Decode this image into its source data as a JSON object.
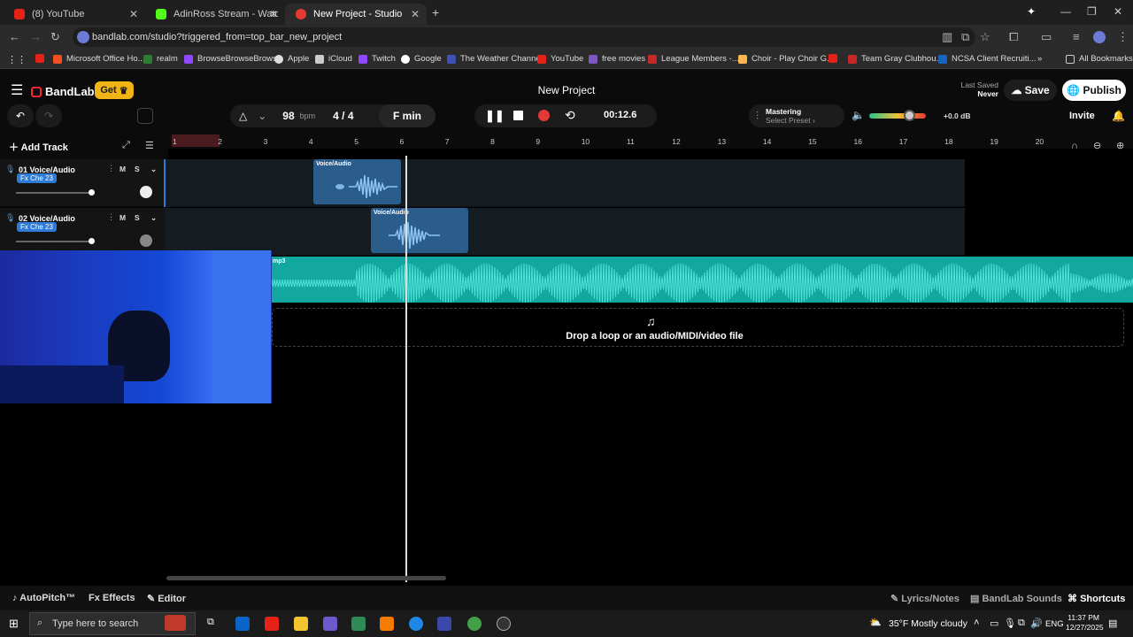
{
  "browser": {
    "tabs": [
      {
        "label": "(8) YouTube",
        "color": "#e62117"
      },
      {
        "label": "AdinRoss Stream - Watch Live o",
        "color": "#53fc18"
      },
      {
        "label": "New Project - Studio",
        "color": "#e53935"
      }
    ],
    "url": "bandlab.com/studio?triggered_from=top_bar_new_project",
    "bookmarks": [
      "Microsoft Office Ho...",
      "realm",
      "BrowseBrowseBrowse",
      "Apple",
      "iCloud",
      "Twitch",
      "Google",
      "The Weather Channel",
      "YouTube",
      "free movies",
      "League Members -...",
      "Choir - Play Choir G...",
      "Team Gray Clubhou...",
      "NCSA Client Recruiti..."
    ],
    "all_bookmarks": "All Bookmarks"
  },
  "app": {
    "brand": "BandLab",
    "get_label": "Get",
    "project_title": "New Project",
    "last_saved_label": "Last Saved",
    "last_saved_value": "Never",
    "save_label": "Save",
    "publish_label": "Publish",
    "invite_label": "Invite"
  },
  "toolbar": {
    "bpm_value": "98",
    "bpm_unit": "bpm",
    "time_sig": "4 / 4",
    "key": "F min",
    "time": "00:12.6",
    "mastering_label": "Mastering",
    "mastering_sub": "Select Preset",
    "volume_db": "+0.0 dB",
    "volume_level": 0.7
  },
  "tracks_panel": {
    "add_track": "Add Track",
    "tracks": [
      {
        "name": "01  Voice/Audio",
        "fx": "Fx Che 23",
        "m": "M",
        "s": "S"
      },
      {
        "name": "02  Voice/Audio",
        "fx": "Fx Che 23",
        "m": "M",
        "s": "S"
      }
    ]
  },
  "ruler": [
    "1",
    "2",
    "3",
    "4",
    "5",
    "6",
    "7",
    "8",
    "9",
    "10",
    "11",
    "12",
    "13",
    "14",
    "15",
    "16",
    "17",
    "18",
    "19",
    "20"
  ],
  "clips": {
    "clip1": "Voice/Audio",
    "clip2": "Voice/Audio",
    "clip3": "mp3"
  },
  "dropzone": "Drop a loop or an audio/MIDI/video file",
  "bottom": {
    "autopitch": "AutoPitch™",
    "effects": "Effects",
    "editor": "Editor",
    "lyrics": "Lyrics/Notes",
    "sounds": "BandLab Sounds",
    "shortcuts": "Shortcuts"
  },
  "taskbar": {
    "search_placeholder": "Type here to search",
    "weather": "35°F  Mostly cloudy",
    "lang": "ENG",
    "time": "11:37 PM",
    "date": "12/27/2025"
  }
}
